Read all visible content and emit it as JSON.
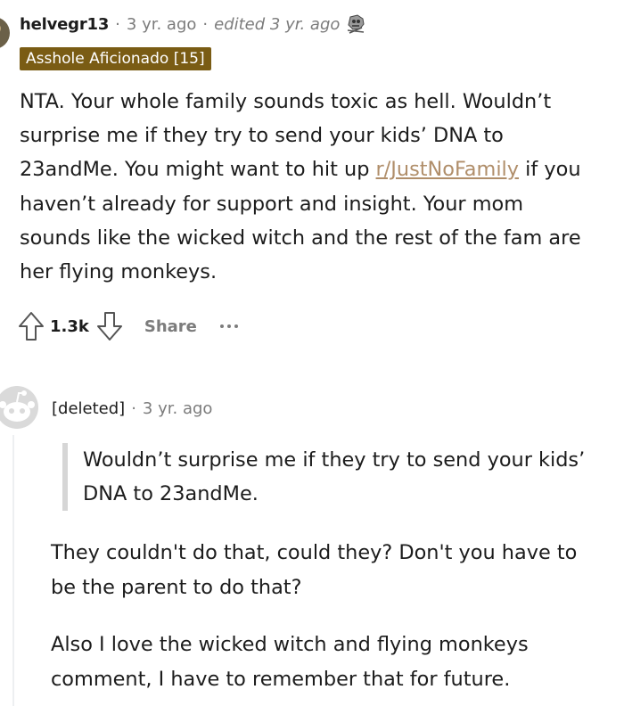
{
  "comment_1": {
    "username": "helvegr13",
    "age": "3 yr. ago",
    "edited": "edited 3 yr. ago",
    "award_icon": "skull-award-icon",
    "flair": "Asshole Aficionado [15]",
    "body_lines": [
      "NTA. Your whole family sounds toxic as hell. Wouldn’t",
      "surprise me if they try to send your kids’ DNA to",
      "23andMe. You might want to hit up ",
      " if you",
      "haven’t already for support and insight. Your mom",
      "sounds like the wicked witch and the rest of the fam are",
      "her flying monkeys."
    ],
    "subreddit_link": "r/JustNoFamily",
    "score": "1.3k",
    "share_label": "Share",
    "upvote_icon": "upvote-arrow-icon",
    "downvote_icon": "downvote-arrow-icon",
    "more_icon": "more-options-icon"
  },
  "comment_2": {
    "username": "[deleted]",
    "age": "3 yr. ago",
    "avatar_icon": "default-snoo-avatar-icon",
    "quote_lines": [
      "Wouldn’t surprise me if they try to send your kids’",
      "DNA to 23andMe."
    ],
    "paragraph_1": [
      "They couldn't do that, could they? Don't you have to",
      "be the parent to do that?"
    ],
    "paragraph_2": [
      "Also I love the wicked witch and flying monkeys",
      "comment, I have to remember that for future."
    ]
  },
  "colors": {
    "flair_bg": "#7a5c14",
    "link": "#b08e6a",
    "meta_gray": "#7c7c7c",
    "quote_bar": "#d6d6d6"
  }
}
